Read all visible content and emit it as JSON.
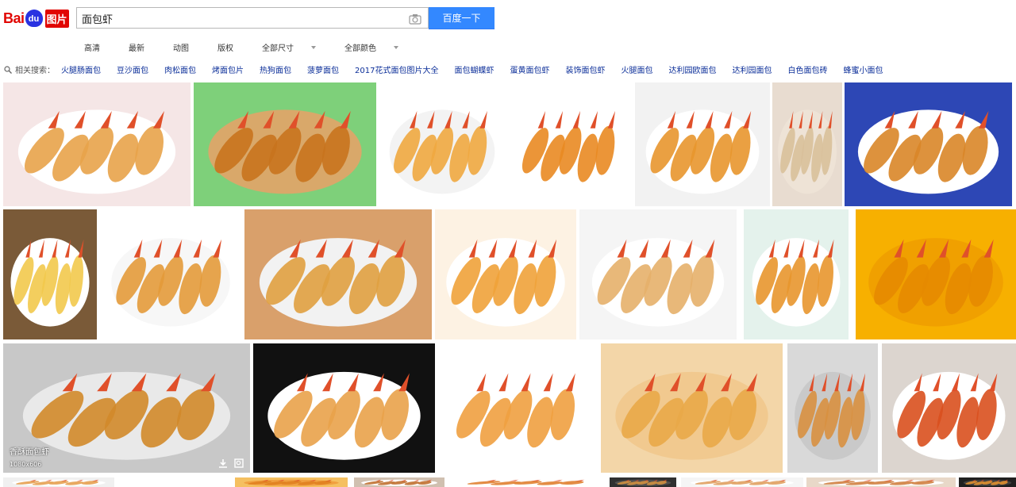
{
  "logo": {
    "text_left": "Bai",
    "text_du": "du",
    "text_right": "图片"
  },
  "search": {
    "value": "面包虾",
    "button_label": "百度一下"
  },
  "filters": [
    {
      "label": "高清",
      "dropdown": false
    },
    {
      "label": "最新",
      "dropdown": false
    },
    {
      "label": "动图",
      "dropdown": false
    },
    {
      "label": "版权",
      "dropdown": false
    },
    {
      "label": "全部尺寸",
      "dropdown": true
    },
    {
      "label": "全部颜色",
      "dropdown": true
    }
  ],
  "related": {
    "label": "相关搜索：",
    "items": [
      "火腿肠面包",
      "豆沙面包",
      "肉松面包",
      "烤面包片",
      "热狗面包",
      "菠萝面包",
      "2017花式面包图片大全",
      "面包蝴蝶虾",
      "蛋黄面包虾",
      "装饰面包虾",
      "火腿面包",
      "达利园欧面包",
      "达利园面包",
      "白色面包砖",
      "蜂蜜小面包"
    ]
  },
  "images": [
    {
      "name": "fried-shrimp-white-plate-pink",
      "bg": "#f5e6e6",
      "plate": "#ffffff",
      "food": "#e8a34a"
    },
    {
      "name": "fried-shrimp-green-plate",
      "bg": "#7ed07a",
      "plate": "#d9a86a",
      "food": "#c8731e"
    },
    {
      "name": "fried-shrimp-tray-logo",
      "bg": "#ffffff",
      "plate": "#f3f3f3",
      "food": "#f0a840"
    },
    {
      "name": "fried-shrimp-closeup",
      "bg": "#ffffff",
      "plate": "#ffffff",
      "food": "#e98a22"
    },
    {
      "name": "fried-shrimp-salad-plate",
      "bg": "#f2f2f2",
      "plate": "#ffffff",
      "food": "#e8962e"
    },
    {
      "name": "shrimp-wrap-pale",
      "bg": "#e8dcd0",
      "plate": "#eee3d6",
      "food": "#d8c09a"
    },
    {
      "name": "fried-shrimp-blue-plate",
      "bg": "#2d47b5",
      "plate": "#ffffff",
      "food": "#d98628"
    },
    {
      "name": "shrimp-rolls-bamboo",
      "bg": "#7a5a38",
      "plate": "#ffffff",
      "food": "#f2c94c"
    },
    {
      "name": "fried-shrimp-pink-flowers",
      "bg": "#ffffff",
      "plate": "#f7f7f7",
      "food": "#e39a3a"
    },
    {
      "name": "fried-shrimp-ketchup",
      "bg": "#d9a06b",
      "plate": "#f2f2f2",
      "food": "#e0a040"
    },
    {
      "name": "shrimp-ad-orange",
      "bg": "#fdf2e3",
      "plate": "#ffffff",
      "food": "#f0a23a"
    },
    {
      "name": "shrimp-noodle-plate",
      "bg": "#f5f5f5",
      "plate": "#ffffff",
      "food": "#e6b06a"
    },
    {
      "name": "shrimp-collage",
      "bg": "#e4f2ec",
      "plate": "#ffffff",
      "food": "#e8962e"
    },
    {
      "name": "golden-crumb-closeup",
      "bg": "#f7b000",
      "plate": "#f0a000",
      "food": "#e68a00"
    },
    {
      "name": "crumb-shrimp-gray-plate",
      "bg": "#c8c8c8",
      "plate": "#e9e9e9",
      "food": "#d18a2a",
      "title": "香酥面包虾",
      "size": "1080x606"
    },
    {
      "name": "fried-shrimp-black-bg",
      "bg": "#111111",
      "plate": "#ffffff",
      "food": "#e9a24a"
    },
    {
      "name": "fried-shrimp-white-bg",
      "bg": "#ffffff",
      "plate": "#ffffff",
      "food": "#f0a040"
    },
    {
      "name": "fried-shrimp-red-chili",
      "bg": "#f3d6a8",
      "plate": "#f1c98f",
      "food": "#e9a848"
    },
    {
      "name": "shrimp-pizza-table",
      "bg": "#d9d9d9",
      "plate": "#c9c9c9",
      "food": "#d89040"
    },
    {
      "name": "spicy-shrimp-white-plate",
      "bg": "#dcd5cf",
      "plate": "#ffffff",
      "food": "#d9501e"
    },
    {
      "name": "bottom-row-1",
      "bg": "#f0f0f0",
      "plate": "#ffffff",
      "food": "#e5a050"
    },
    {
      "name": "bottom-row-2",
      "bg": "#f5c060",
      "plate": "#f0a040",
      "food": "#e08020"
    },
    {
      "name": "bottom-row-3",
      "bg": "#d0c0b0",
      "plate": "#ffffff",
      "food": "#c07030"
    },
    {
      "name": "bottom-row-4",
      "bg": "#ffffff",
      "plate": "#ffffff",
      "food": "#e08030"
    },
    {
      "name": "bottom-row-5",
      "bg": "#303030",
      "plate": "#505050",
      "food": "#d09040"
    },
    {
      "name": "bottom-row-6",
      "bg": "#f5f5f5",
      "plate": "#ffffff",
      "food": "#e0a060"
    },
    {
      "name": "bottom-row-7",
      "bg": "#e8d8c8",
      "plate": "#ffffff",
      "food": "#d08040"
    },
    {
      "name": "bottom-row-8",
      "bg": "#202020",
      "plate": "#404040",
      "food": "#e09030"
    }
  ],
  "colors": {
    "accent": "#3388ff",
    "brand_red": "#e10602",
    "brand_blue": "#2932e1",
    "link": "#0b2e99"
  },
  "icons": {
    "camera": "camera-icon",
    "search_small": "magnifier-icon",
    "download": "download-icon",
    "zoom": "zoom-icon"
  }
}
